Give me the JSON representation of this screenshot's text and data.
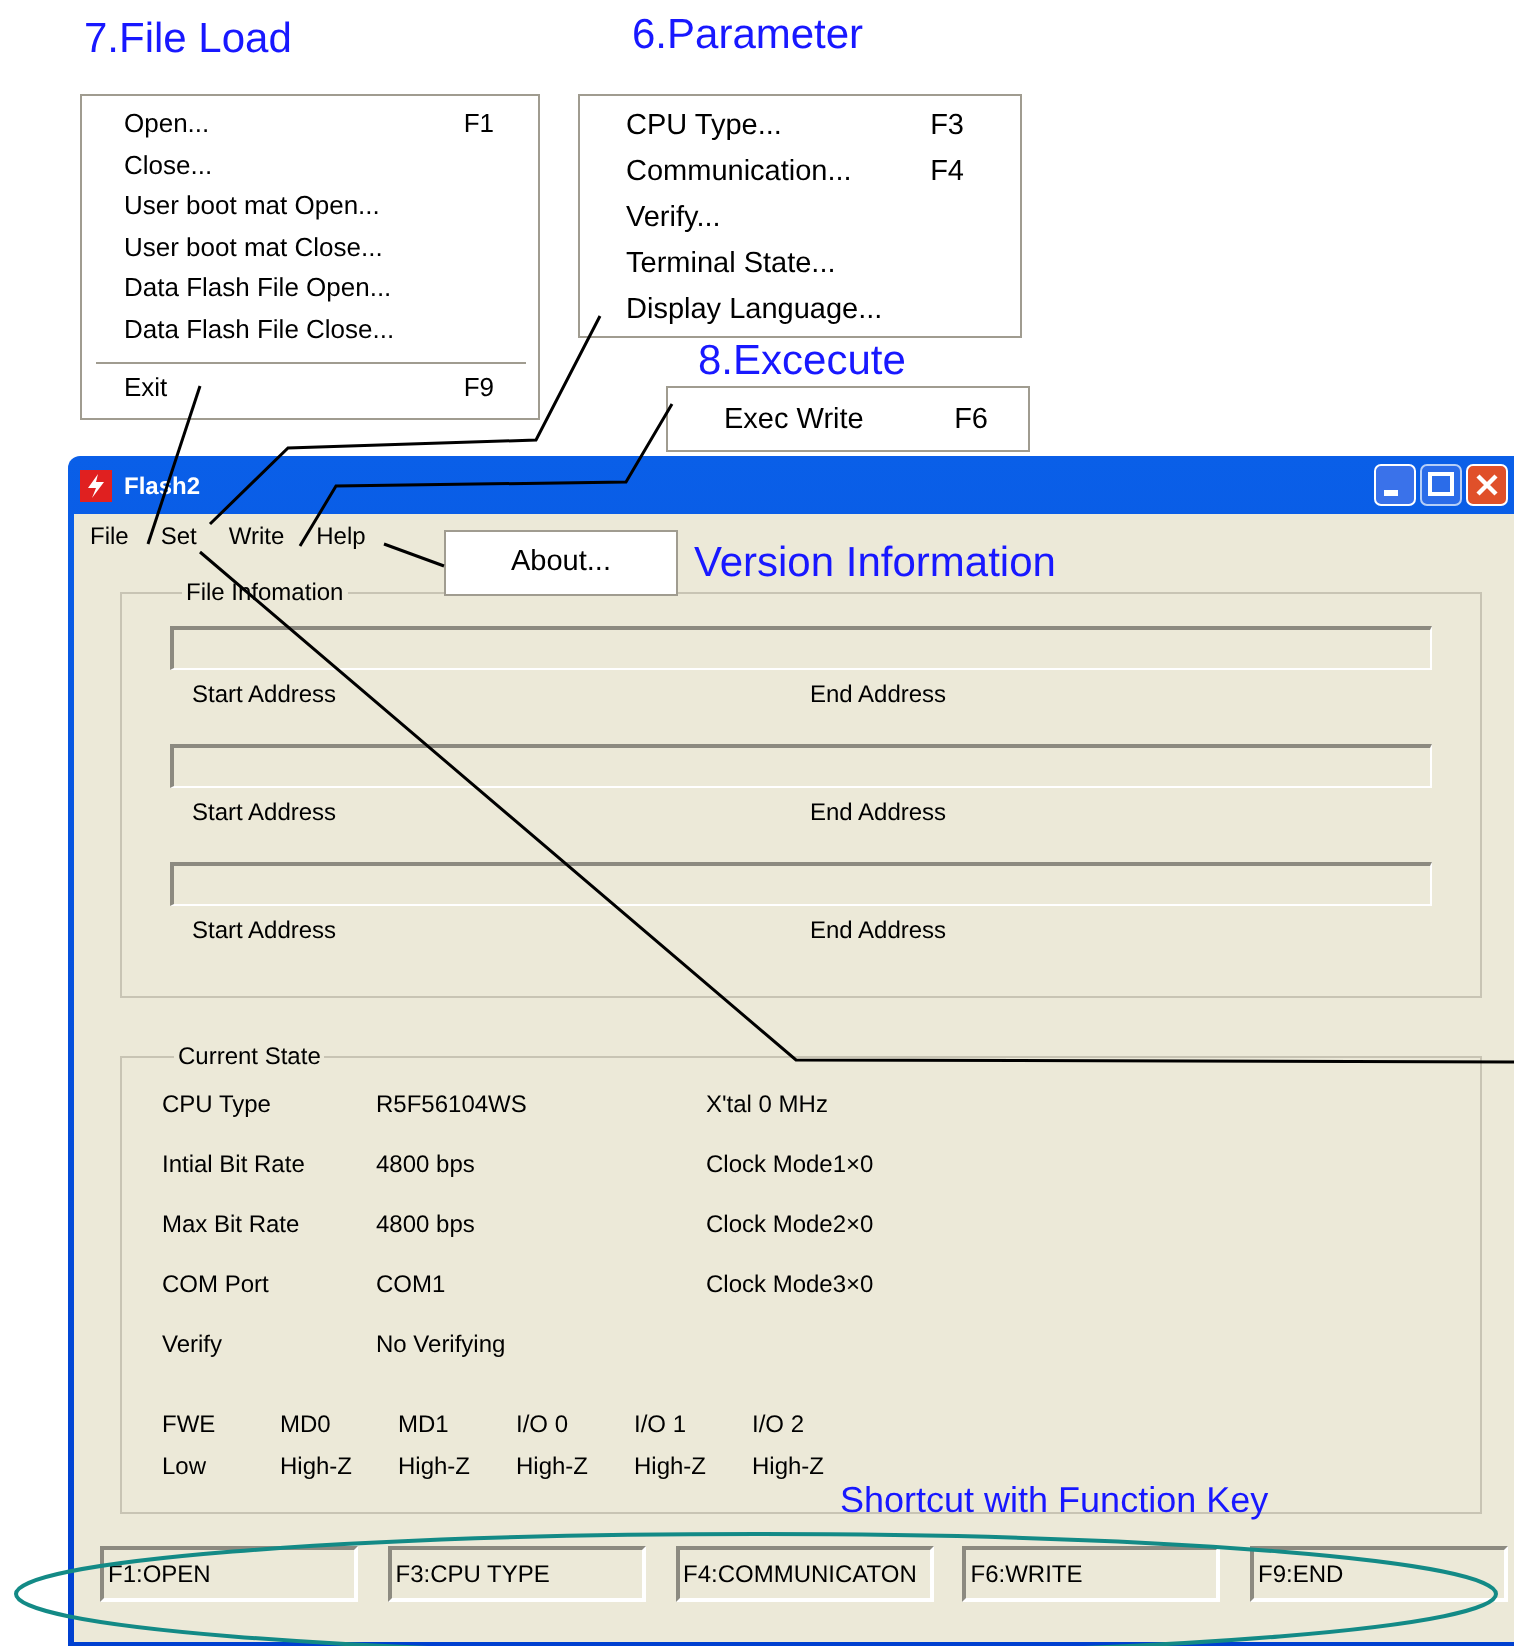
{
  "callouts": {
    "file_load": {
      "title": "7.File Load",
      "items": [
        {
          "kind": "item",
          "label": "Open...",
          "shortcut": "F1"
        },
        {
          "kind": "item",
          "label": "Close..."
        },
        {
          "kind": "item",
          "label": "User boot mat Open..."
        },
        {
          "kind": "item",
          "label": "User boot mat Close..."
        },
        {
          "kind": "item",
          "label": "Data Flash File Open..."
        },
        {
          "kind": "item",
          "label": "Data Flash File Close..."
        },
        {
          "kind": "separator"
        },
        {
          "kind": "item",
          "label": "Exit",
          "shortcut": "F9"
        }
      ]
    },
    "parameter": {
      "title": "6.Parameter",
      "items": [
        {
          "kind": "item",
          "label": "CPU Type...",
          "shortcut": "F3"
        },
        {
          "kind": "item",
          "label": "Communication...",
          "shortcut": "F4"
        },
        {
          "kind": "item",
          "label": "Verify..."
        },
        {
          "kind": "item",
          "label": "Terminal State..."
        },
        {
          "kind": "item",
          "label": "Display Language..."
        }
      ]
    },
    "execute": {
      "title": "8.Excecute",
      "items": [
        {
          "kind": "item",
          "label": "Exec Write",
          "shortcut": "F6"
        }
      ]
    },
    "version": {
      "title": "Version Information",
      "items": [
        {
          "kind": "item",
          "label": "About..."
        }
      ]
    },
    "shortcut": {
      "title": "Shortcut with Function Key"
    }
  },
  "window": {
    "title": "Flash2"
  },
  "menu_bar": [
    "File",
    "Set",
    "Write",
    "Help"
  ],
  "file_information": {
    "title": "File Infomation",
    "entries": [
      {
        "start_label": "Start Address",
        "end_label": "End Address"
      },
      {
        "start_label": "Start Address",
        "end_label": "End Address"
      },
      {
        "start_label": "Start Address",
        "end_label": "End Address"
      }
    ]
  },
  "current_state": {
    "title": "Current State",
    "rows": [
      {
        "label": "CPU Type",
        "value": "R5F56104WS",
        "extra": "X'tal 0 MHz"
      },
      {
        "label": "Intial Bit Rate",
        "value": "4800 bps",
        "extra": "Clock Mode1×0"
      },
      {
        "label": "Max Bit Rate",
        "value": "4800 bps",
        "extra": "Clock Mode2×0"
      },
      {
        "label": "COM Port",
        "value": "COM1",
        "extra": "Clock Mode3×0"
      },
      {
        "label": "Verify",
        "value": "No Verifying"
      }
    ],
    "pins": [
      {
        "name": "FWE",
        "value": "Low"
      },
      {
        "name": "MD0",
        "value": "High-Z"
      },
      {
        "name": "MD1",
        "value": "High-Z"
      },
      {
        "name": "I/O 0",
        "value": "High-Z"
      },
      {
        "name": "I/O 1",
        "value": "High-Z"
      },
      {
        "name": "I/O 2",
        "value": "High-Z"
      }
    ]
  },
  "status_bar": [
    "F1:OPEN",
    "F3:CPU TYPE",
    "F4:COMMUNICATON",
    "F6:WRITE",
    "F9:END"
  ]
}
